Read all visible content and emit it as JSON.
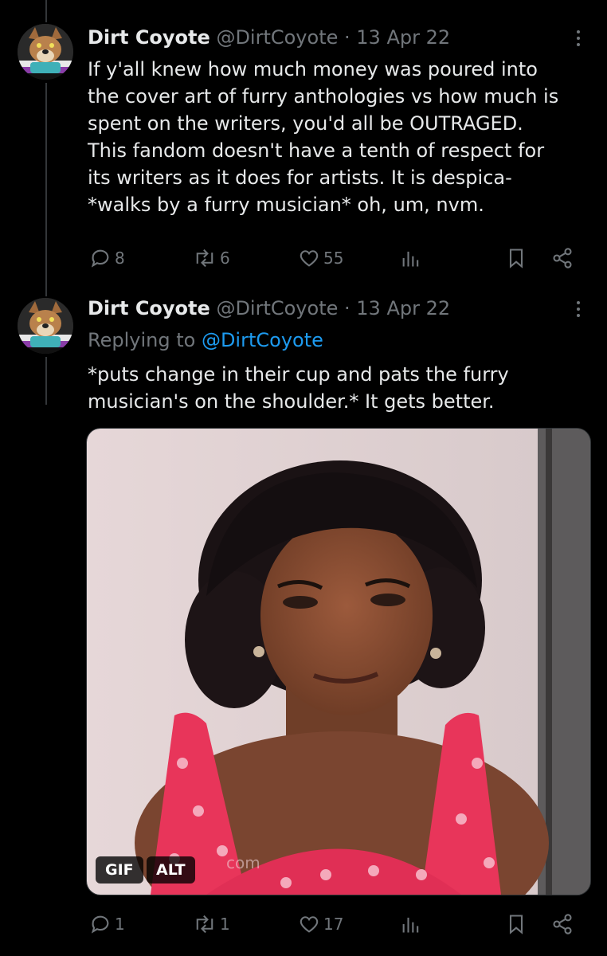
{
  "tweets": [
    {
      "name": "Dirt Coyote",
      "handle": "@DirtCoyote",
      "date": "· 13 Apr 22",
      "lines": [
        "If y'all knew how much money was poured into",
        "the cover art of furry anthologies vs how much is",
        "spent on the writers, you'd all be OUTRAGED.",
        "This fandom doesn't have a tenth of respect for",
        "its writers as it does for artists. It is despica-",
        "*walks by a furry musician* oh, um, nvm."
      ],
      "replies": "8",
      "retweets": "6",
      "likes": "55"
    },
    {
      "name": "Dirt Coyote",
      "handle": "@DirtCoyote",
      "date": "· 13 Apr 22",
      "replying_label": "Replying to",
      "replying_handle": "@DirtCoyote",
      "lines": [
        "*puts change in their cup and pats the furry",
        "musician's on the shoulder.* It gets better."
      ],
      "media": {
        "gif_badge": "GIF",
        "alt_badge": "ALT",
        "watermark": "com"
      },
      "replies": "1",
      "retweets": "1",
      "likes": "17"
    }
  ],
  "icons": [
    "reply-icon",
    "retweet-icon",
    "like-icon",
    "views-icon",
    "bookmark-icon",
    "share-icon",
    "more-icon"
  ],
  "colors": {
    "background": "#000000",
    "text": "#e7e9ea",
    "muted": "#71767b",
    "link": "#1d9bf0"
  }
}
